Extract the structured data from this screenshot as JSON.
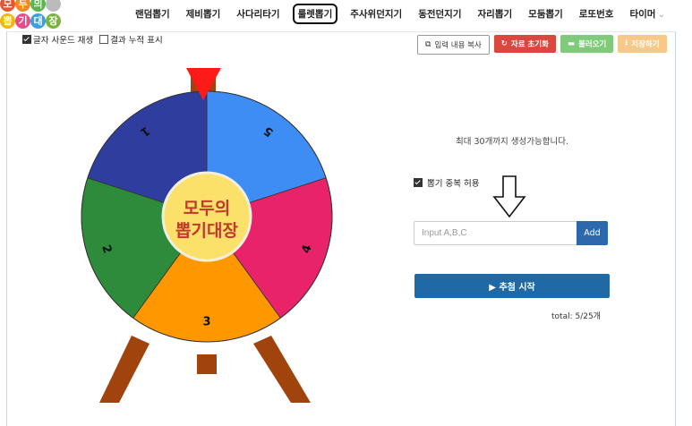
{
  "logo": {
    "chars": [
      {
        "ch": "모",
        "color": "#e8542e"
      },
      {
        "ch": "두",
        "color": "#f08a20"
      },
      {
        "ch": "의",
        "color": "#5ab54a"
      },
      {
        "ch": "",
        "color": "#bbbbbb"
      },
      {
        "ch": "뽑",
        "color": "#f5b40f"
      },
      {
        "ch": "기",
        "color": "#e84c8b"
      },
      {
        "ch": "대",
        "color": "#3da0dc"
      },
      {
        "ch": "장",
        "color": "#7ab53b"
      }
    ]
  },
  "nav": {
    "items": [
      {
        "label": "랜덤뽑기",
        "active": false
      },
      {
        "label": "제비뽑기",
        "active": false
      },
      {
        "label": "사다리타기",
        "active": false
      },
      {
        "label": "룰렛뽑기",
        "active": true
      },
      {
        "label": "주사위던지기",
        "active": false
      },
      {
        "label": "동전던지기",
        "active": false
      },
      {
        "label": "자리뽑기",
        "active": false
      },
      {
        "label": "모둠뽑기",
        "active": false
      },
      {
        "label": "로또번호",
        "active": false
      },
      {
        "label": "타이머",
        "active": false
      }
    ],
    "more_chevron": "⌄"
  },
  "options": {
    "sound_label": "글자 사운드 재생",
    "sound_checked": true,
    "cumulative_label": "결과 누적 표시",
    "cumulative_checked": false
  },
  "toolbar": {
    "copy_label": "입력 내용 복사",
    "reset_label": "자료 초기화",
    "load_label": "불러오기",
    "save_label": "저장하기"
  },
  "wheel": {
    "center_text_line1": "모두의",
    "center_text_line2": "뽑기대장",
    "segments": [
      {
        "label": "5",
        "color": "#3d8df5"
      },
      {
        "label": "4",
        "color": "#e8236a"
      },
      {
        "label": "3",
        "color": "#ff9800"
      },
      {
        "label": "2",
        "color": "#2e8b3c"
      },
      {
        "label": "1",
        "color": "#2f3d9e"
      }
    ],
    "pointer_color": "#ff1a1a",
    "stand_color": "#a0430d"
  },
  "panel": {
    "max_text": "최대 30개까지 생성가능합니다.",
    "dup_label": "뽑기 중복 허용",
    "dup_checked": true,
    "input_placeholder": "Input A,B,C",
    "add_label": "Add",
    "start_label": "▶ 추첨 시작",
    "total_text": "total: 5/25개"
  }
}
